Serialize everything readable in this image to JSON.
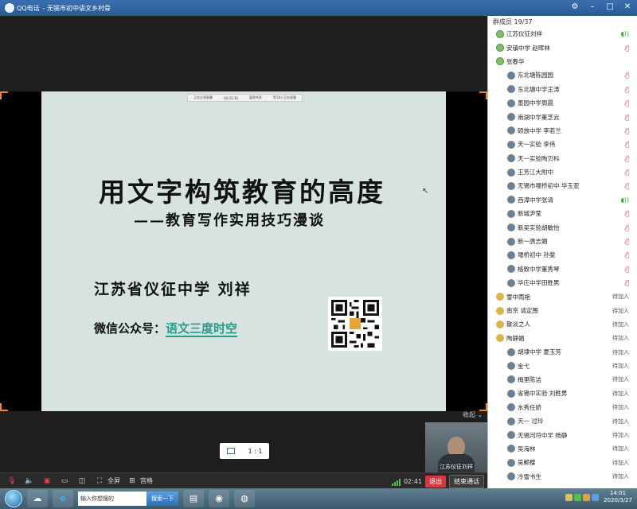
{
  "window": {
    "app": "QQ电话",
    "title": "- 无锡市初中语文乡村骨"
  },
  "slide": {
    "share_bar": [
      "正在分享屏幕",
      "00:03:36",
      "暂停共享",
      "等18人正在观看"
    ],
    "title": "用文字构筑教育的高度",
    "subtitle": "——教育写作实用技巧漫谈",
    "author": "江苏省仪征中学 刘祥",
    "wechat_label": "微信公众号：",
    "wechat_name": "语文三度时空"
  },
  "stage": {
    "collapse_label": "收起",
    "self_name": "江苏仪征刘祥",
    "ratio_label": "1 : 1"
  },
  "controls": {
    "fullscreen_label": "全屏",
    "gallery_label": "宫格",
    "duration": "02:41",
    "exit_label": "退出",
    "end_label": "结束通话"
  },
  "panel": {
    "header": "群成员 19/37",
    "members": [
      {
        "name": "江苏仪征刘祥",
        "level": 1,
        "status": "live"
      },
      {
        "name": "安镇中学 赵晖林",
        "level": 1,
        "status": "mic"
      },
      {
        "name": "张春华",
        "level": 1,
        "status": ""
      },
      {
        "name": "东北塘陈园园",
        "level": 2,
        "status": "mic"
      },
      {
        "name": "东北塘中学王涛",
        "level": 2,
        "status": "mic"
      },
      {
        "name": "墨园中学周晨",
        "level": 2,
        "status": "mic"
      },
      {
        "name": "南湖中学董芝云",
        "level": 2,
        "status": "mic"
      },
      {
        "name": "硕放中学 李若兰",
        "level": 2,
        "status": "mic"
      },
      {
        "name": "天一实验 李伟",
        "level": 2,
        "status": "mic"
      },
      {
        "name": "天一实验陶贝科",
        "level": 2,
        "status": "mic"
      },
      {
        "name": "王芳江大附中",
        "level": 2,
        "status": "mic"
      },
      {
        "name": "无锡市堰桥初中 华玉亚",
        "level": 2,
        "status": "mic"
      },
      {
        "name": "西漳中学张清",
        "level": 2,
        "status": "live"
      },
      {
        "name": "新城尹莹",
        "level": 2,
        "status": "mic"
      },
      {
        "name": "新吴实验胡敏怡",
        "level": 2,
        "status": "mic"
      },
      {
        "name": "新一唐志娟",
        "level": 2,
        "status": "mic"
      },
      {
        "name": "堰桥初中 孙斐",
        "level": 2,
        "status": "mic"
      },
      {
        "name": "格致中学董秀琴",
        "level": 2,
        "status": "mic"
      },
      {
        "name": "华庄中学田胜男",
        "level": 2,
        "status": "mic"
      },
      {
        "name": "雪中雨艳",
        "level": 3,
        "status": "待加入"
      },
      {
        "name": "南京 请定围",
        "level": 3,
        "status": "待加入"
      },
      {
        "name": "散淡之人",
        "level": 3,
        "status": "待加入"
      },
      {
        "name": "陶静娟",
        "level": 3,
        "status": "待加入"
      },
      {
        "name": "胡埭中学 夏玉芳",
        "level": 2,
        "status": "待加入"
      },
      {
        "name": "金弋",
        "level": 2,
        "status": "待加入"
      },
      {
        "name": "梅里陈洁",
        "level": 2,
        "status": "待加入"
      },
      {
        "name": "省锡中实验 刘胜男",
        "level": 2,
        "status": "待加入"
      },
      {
        "name": "水秀任娇",
        "level": 2,
        "status": "待加入"
      },
      {
        "name": "天一 过玲",
        "level": 2,
        "status": "待加入"
      },
      {
        "name": "无锡河埒中学 杨静",
        "level": 2,
        "status": "待加入"
      },
      {
        "name": "吴海林",
        "level": 2,
        "status": "待加入"
      },
      {
        "name": "吴赖樱",
        "level": 2,
        "status": "待加入"
      },
      {
        "name": "冷雪书生",
        "level": 2,
        "status": "待加入"
      }
    ]
  },
  "taskbar": {
    "search_placeholder": "输入你想搜的",
    "search_button": "搜索一下",
    "time": "14:01",
    "date": "2020/3/27"
  }
}
